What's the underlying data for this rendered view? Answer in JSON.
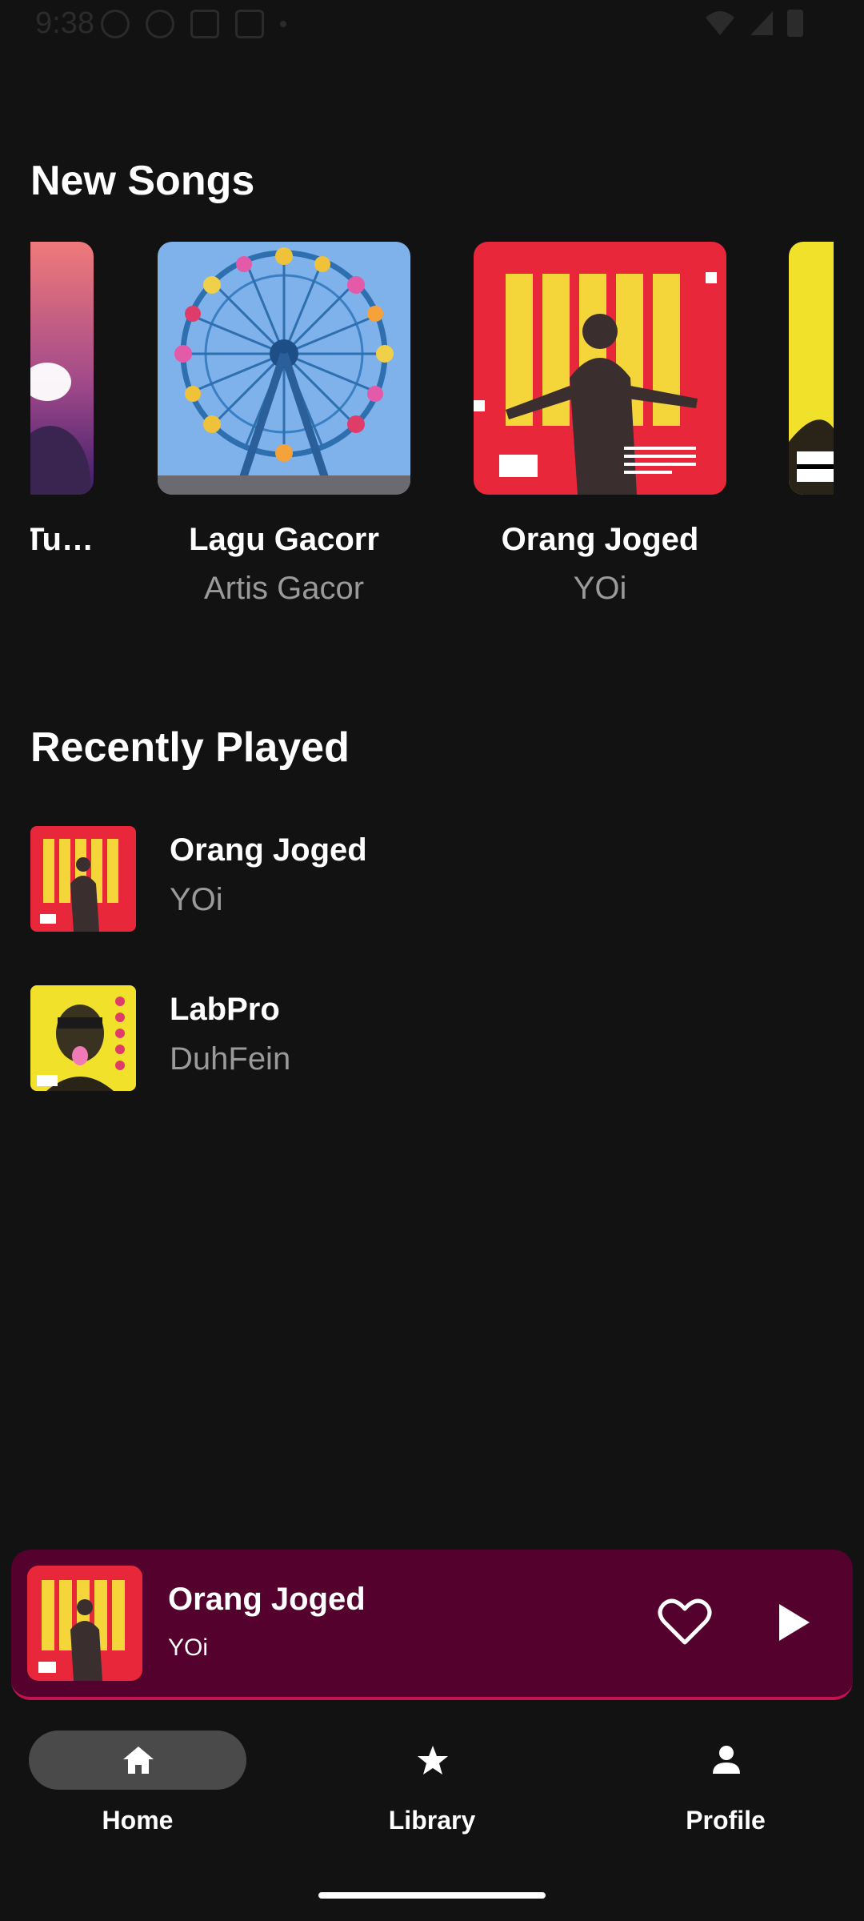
{
  "status_bar": {
    "time": "9:38"
  },
  "new_songs": {
    "title": "New Songs",
    "items": [
      {
        "title": "Tu…",
        "artist": ""
      },
      {
        "title": "Lagu Gacorr",
        "artist": "Artis Gacor"
      },
      {
        "title": "Orang Joged",
        "artist": "YOi"
      },
      {
        "title": "",
        "artist": ""
      }
    ]
  },
  "recently_played": {
    "title": "Recently Played",
    "items": [
      {
        "title": "Orang Joged",
        "artist": "YOi"
      },
      {
        "title": "LabPro",
        "artist": "DuhFein"
      }
    ]
  },
  "mini_player": {
    "title": "Orang Joged",
    "artist": "YOi",
    "heart_icon": "heart-outline-icon",
    "play_icon": "play-icon",
    "accent_color": "#54012e",
    "progress_color": "#c2134f"
  },
  "bottom_nav": {
    "items": [
      {
        "label": "Home",
        "icon": "home-icon",
        "selected": true
      },
      {
        "label": "Library",
        "icon": "star-icon",
        "selected": false
      },
      {
        "label": "Profile",
        "icon": "person-icon",
        "selected": false
      }
    ]
  },
  "colors": {
    "background": "#121212",
    "secondary_text": "#9a9a9a",
    "nav_pill": "#4a4a4a"
  }
}
